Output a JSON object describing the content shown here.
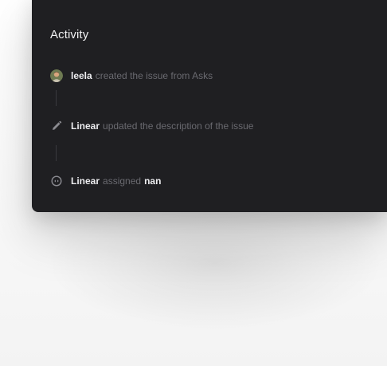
{
  "activity": {
    "title": "Activity",
    "events": [
      {
        "actor": "leela",
        "action": "created the issue from Asks",
        "icon": "avatar"
      },
      {
        "actor": "Linear",
        "action": "updated the description of the issue",
        "icon": "pencil-icon"
      },
      {
        "actor": "Linear",
        "action": "assigned",
        "target": "nan",
        "icon": "assign-icon"
      }
    ]
  },
  "colors": {
    "panel_bg": "#1f1f22",
    "primary_text": "#ededf0",
    "muted_text": "#6a6a70"
  }
}
